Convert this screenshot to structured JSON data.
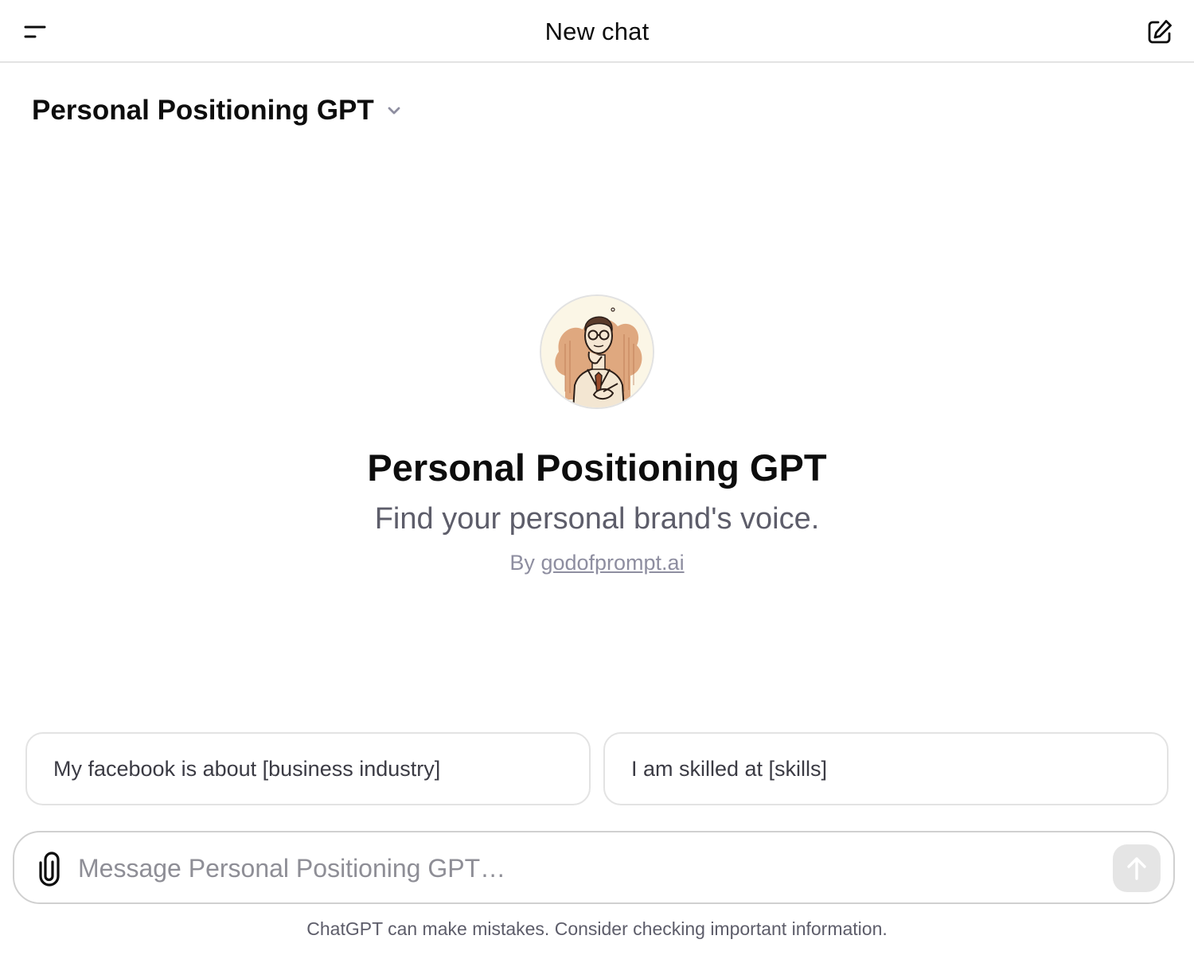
{
  "header": {
    "menu_icon": "sidebar-toggle-icon",
    "title": "New chat",
    "new_chat_icon": "edit-icon"
  },
  "model_selector": {
    "label": "Personal Positioning GPT",
    "icon": "chevron-down-icon"
  },
  "gpt": {
    "avatar_icon": "man-with-glasses-portrait",
    "name": "Personal Positioning GPT",
    "description": "Find your personal brand's voice.",
    "by_prefix": "By",
    "author": "godofprompt.ai"
  },
  "suggestions": [
    {
      "label": "My facebook is about [business industry]"
    },
    {
      "label": "I am skilled at [skills]"
    }
  ],
  "composer": {
    "attach_icon": "paperclip-icon",
    "placeholder": "Message Personal Positioning GPT…",
    "value": "",
    "send_icon": "arrow-up-icon"
  },
  "footer": {
    "disclaimer": "ChatGPT can make mistakes. Consider checking important information."
  },
  "colors": {
    "text": "#0d0d0d",
    "muted": "#5d5d6a",
    "border": "#e3e3e3",
    "send_disabled": "#e5e5e5",
    "avatar_accent": "#d99a6c"
  }
}
